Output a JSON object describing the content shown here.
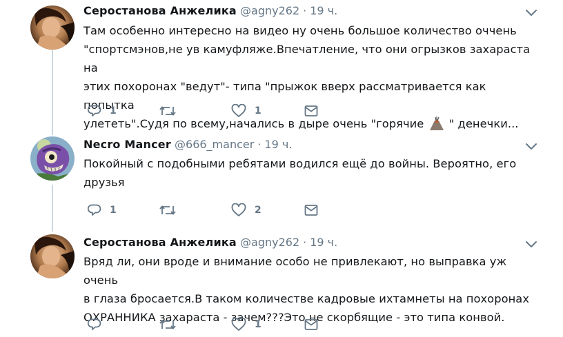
{
  "tweets": [
    {
      "author_name": "Серостанова Анжелика",
      "handle": "@agny262",
      "separator": "·",
      "time": "19 ч.",
      "avatar": "woman-photo-avatar",
      "text_before_emoji": "Там особенно интересно на видео ну очень большое количество оччень\n\"спортсмэнов,не ув камуфляже.Впечатление, что они огрызков захараста на\nэтих похоронах \"ведут\"- типа \"прыжок вверх рассматривается как попытка\nулететь\".Судя по всему,начались в дыре очень \"горячие ",
      "emoji": "volcano-emoji",
      "text_after_emoji": " \" денечки...",
      "reply_count": "1",
      "retweet_count": "",
      "like_count": "1"
    },
    {
      "author_name": "Necro Mancer",
      "handle": "@666_mancer",
      "separator": "·",
      "time": "19 ч.",
      "avatar": "cartoon-monster-avatar",
      "text": "Покойный с подобными ребятами водился ещё до войны. Вероятно, его\nдрузья",
      "reply_count": "1",
      "retweet_count": "",
      "like_count": "2"
    },
    {
      "author_name": "Серостанова Анжелика",
      "handle": "@agny262",
      "separator": "·",
      "time": "19 ч.",
      "avatar": "woman-photo-avatar",
      "text": "Вряд ли, они вроде и внимание особо не привлекают, но выправка уж очень\nв глаза бросается.В таком количестве кадровые ихтамнеты на похоронах\nОХРАННИКА захараста - зачем???Это не скорбящие - это типа конвой.",
      "reply_count": "",
      "retweet_count": "",
      "like_count": "1"
    }
  ],
  "icons": {
    "reply": "reply-icon",
    "retweet": "retweet-icon",
    "like": "heart-icon",
    "message": "direct-message-icon",
    "menu": "chevron-down-icon"
  },
  "colors": {
    "text": "#14171a",
    "secondary": "#657786",
    "thread_line": "#ccd6dd",
    "background": "#ffffff"
  }
}
